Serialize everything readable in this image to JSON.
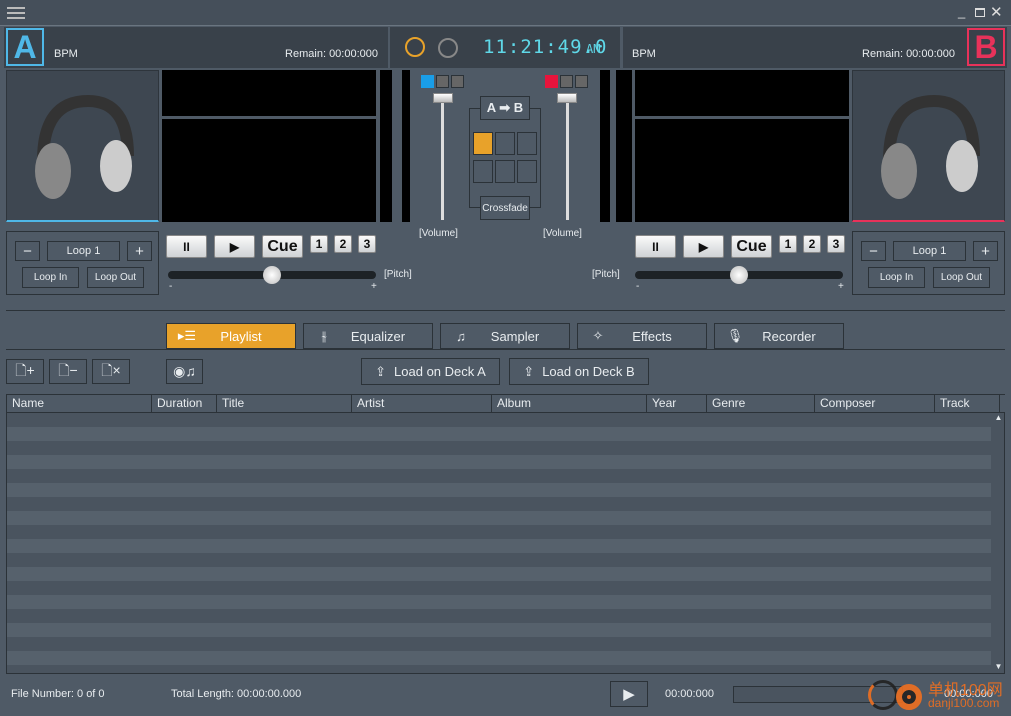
{
  "window": {
    "menu_icon": "hamburger-icon",
    "controls": [
      "minimize",
      "maximize",
      "close"
    ]
  },
  "deck_a": {
    "letter": "A",
    "bpm_label": "BPM",
    "remain": "Remain: 00:00:000",
    "color": "#4fb8e8",
    "loop_label": "Loop 1",
    "loop_minus": "−",
    "loop_plus": "+",
    "loop_in": "Loop In",
    "loop_out": "Loop Out",
    "pause": "II",
    "play": "▶",
    "cue": "Cue",
    "hot1": "1",
    "hot2": "2",
    "hot3": "3",
    "pitch_label": "[Pitch]",
    "pitch_minus": "-",
    "pitch_plus": "+",
    "volume_label": "[Volume]",
    "pitch_value": 0.5,
    "volume_value": 1.0
  },
  "deck_b": {
    "letter": "B",
    "bpm_label": "BPM",
    "remain": "Remain: 00:00:000",
    "color": "#e8325a",
    "loop_label": "Loop 1",
    "loop_minus": "−",
    "loop_plus": "+",
    "loop_in": "Loop In",
    "loop_out": "Loop Out",
    "pause": "II",
    "play": "▶",
    "cue": "Cue",
    "hot1": "1",
    "hot2": "2",
    "hot3": "3",
    "pitch_label": "[Pitch]",
    "pitch_minus": "-",
    "pitch_plus": "+",
    "volume_label": "[Volume]",
    "pitch_value": 0.5,
    "volume_value": 1.0
  },
  "clock": {
    "time": "11:21:49.0",
    "ampm": "AM",
    "color": "#5fd8e8"
  },
  "mixer": {
    "a_to_b": "A ➡ B",
    "crossfade": "Crossfade",
    "accent": "#e8a22a"
  },
  "tabs": [
    {
      "label": "Playlist",
      "icon": "list-icon"
    },
    {
      "label": "Equalizer",
      "icon": "equalizer-icon"
    },
    {
      "label": "Sampler",
      "icon": "music-note-icon"
    },
    {
      "label": "Effects",
      "icon": "sparkles-icon"
    },
    {
      "label": "Recorder",
      "icon": "microphone-icon"
    }
  ],
  "toolbar": {
    "load_a": "Load on Deck A",
    "load_b": "Load on Deck B"
  },
  "table": {
    "columns": [
      "Name",
      "Duration",
      "Title",
      "Artist",
      "Album",
      "Year",
      "Genre",
      "Composer",
      "Track"
    ],
    "rows": []
  },
  "status": {
    "file_number": "File Number: 0 of 0",
    "total_length": "Total Length: 00:00:00.000",
    "time_start": "00:00:000",
    "time_end": "00:00:000"
  },
  "watermark": {
    "text": "单机100网",
    "url": "danji100.com"
  }
}
